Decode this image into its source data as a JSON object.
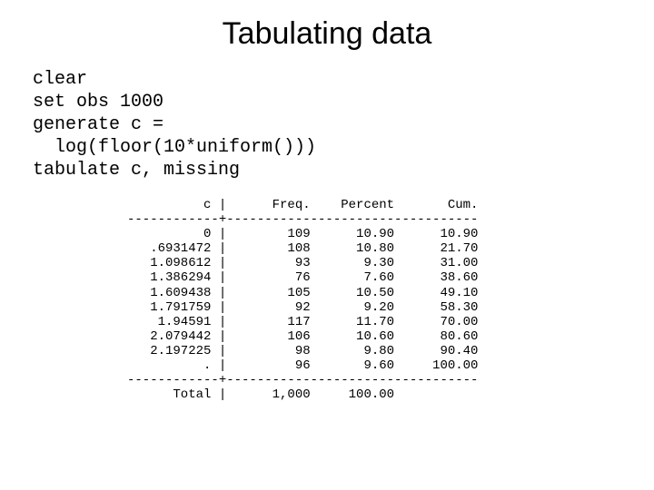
{
  "title": "Tabulating data",
  "code_lines": [
    "clear",
    "set obs 1000",
    "generate c =",
    "  log(floor(10*uniform()))",
    "tabulate c, missing"
  ],
  "chart_data": {
    "type": "table",
    "columns": [
      "c",
      "Freq.",
      "Percent",
      "Cum."
    ],
    "rows": [
      {
        "c": "0",
        "freq": 109,
        "percent": 10.9,
        "cum": 10.9
      },
      {
        "c": ".6931472",
        "freq": 108,
        "percent": 10.8,
        "cum": 21.7
      },
      {
        "c": "1.098612",
        "freq": 93,
        "percent": 9.3,
        "cum": 31.0
      },
      {
        "c": "1.386294",
        "freq": 76,
        "percent": 7.6,
        "cum": 38.6
      },
      {
        "c": "1.609438",
        "freq": 105,
        "percent": 10.5,
        "cum": 49.1
      },
      {
        "c": "1.791759",
        "freq": 92,
        "percent": 9.2,
        "cum": 58.3
      },
      {
        "c": "1.94591",
        "freq": 117,
        "percent": 11.7,
        "cum": 70.0
      },
      {
        "c": "2.079442",
        "freq": 106,
        "percent": 10.6,
        "cum": 80.6
      },
      {
        "c": "2.197225",
        "freq": 98,
        "percent": 9.8,
        "cum": 90.4
      },
      {
        "c": ".",
        "freq": 96,
        "percent": 9.6,
        "cum": 100.0
      }
    ],
    "total": {
      "label": "Total",
      "freq": 1000,
      "percent": 100.0
    }
  }
}
